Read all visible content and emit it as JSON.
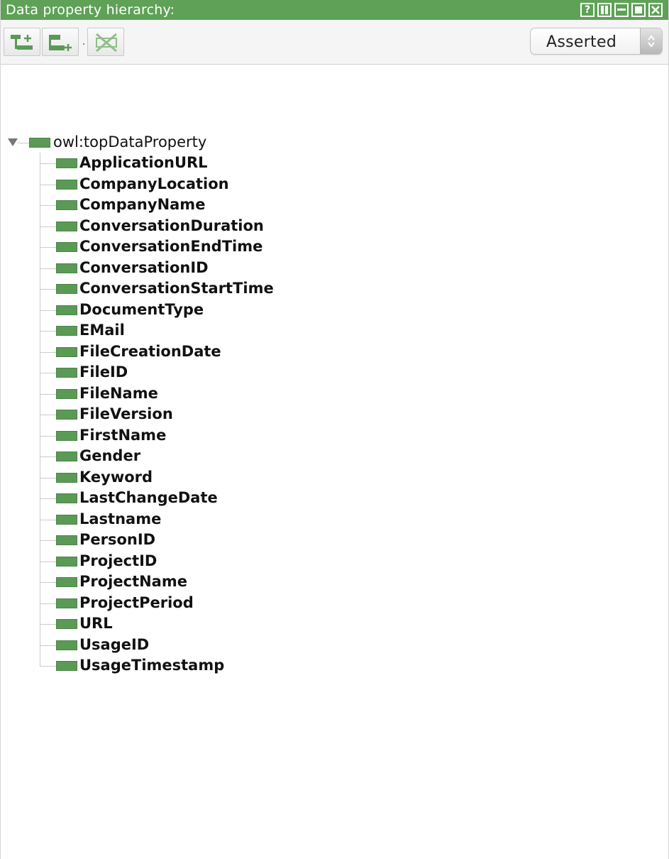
{
  "window": {
    "title": "Data property hierarchy:",
    "buttons": [
      "?",
      "▮▮",
      "▬",
      "■",
      "✕"
    ]
  },
  "toolbar": {
    "buttons": [
      "add-subproperty",
      "add-sibling-property",
      "delete-property"
    ],
    "view_mode": "Asserted"
  },
  "tree": {
    "root": "owl:topDataProperty",
    "children": [
      "ApplicationURL",
      "CompanyLocation",
      "CompanyName",
      "ConversationDuration",
      "ConversationEndTime",
      "ConversationID",
      "ConversationStartTime",
      "DocumentType",
      "EMail",
      "FileCreationDate",
      "FileID",
      "FileName",
      "FileVersion",
      "FirstName",
      "Gender",
      "Keyword",
      "LastChangeDate",
      "Lastname",
      "PersonID",
      "ProjectID",
      "ProjectName",
      "ProjectPeriod",
      "URL",
      "UsageID",
      "UsageTimestamp"
    ]
  },
  "colors": {
    "titlebar": "#5ea157",
    "property_icon": "#5a9a55"
  }
}
